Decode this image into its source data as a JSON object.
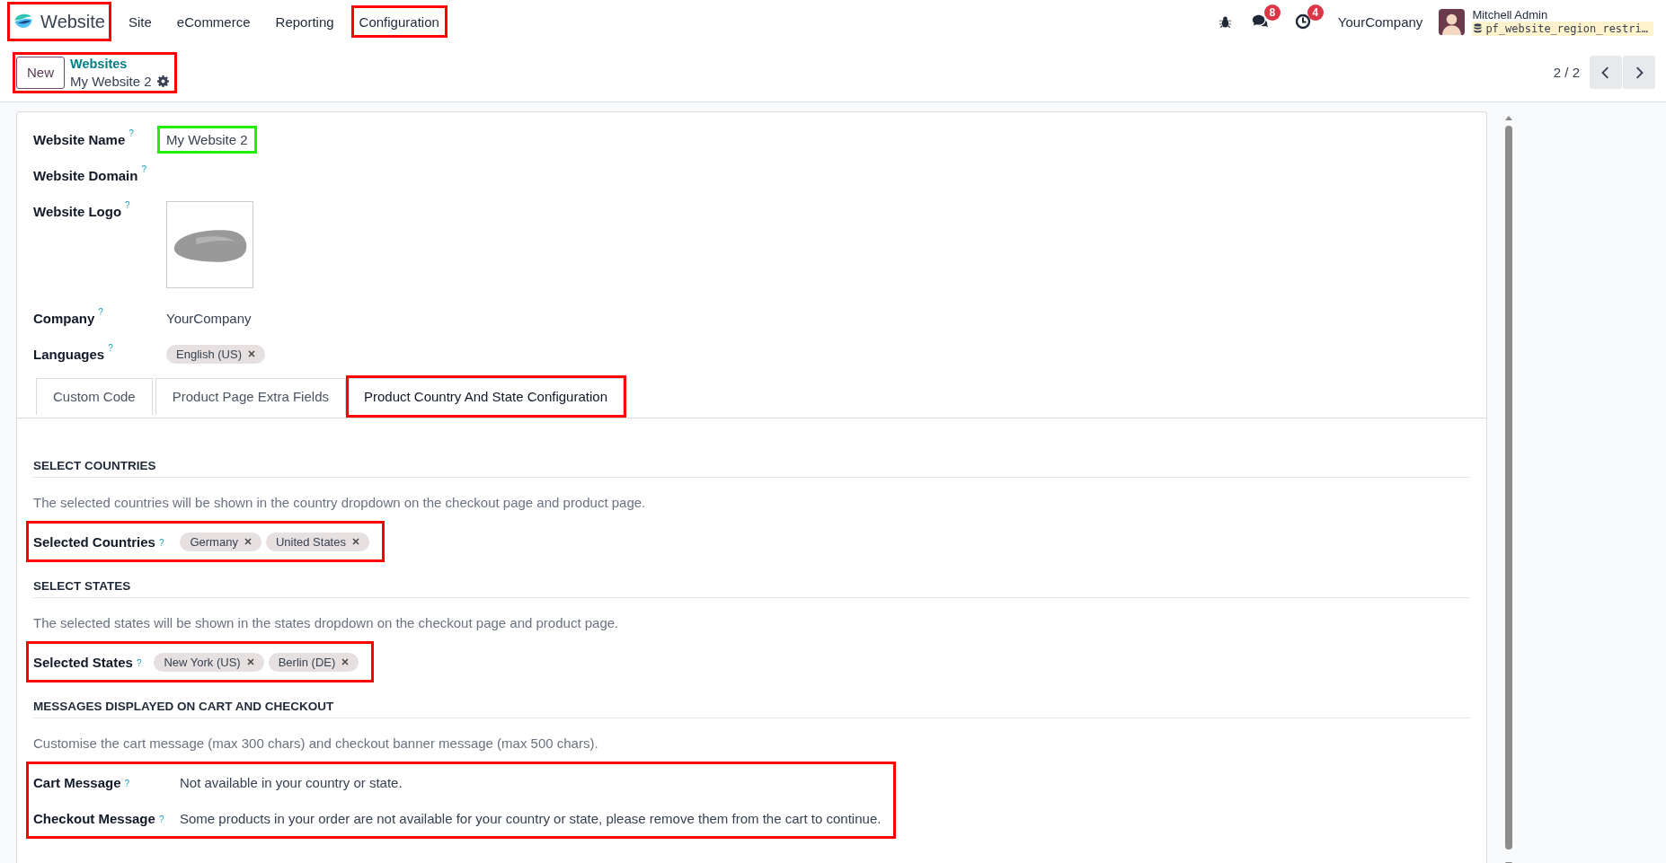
{
  "navbar": {
    "app": {
      "name": "Website",
      "color": "#ff0000"
    },
    "menus": [
      {
        "label": "Site"
      },
      {
        "label": "eCommerce"
      },
      {
        "label": "Reporting"
      },
      {
        "label": "Configuration",
        "color": "#ff0000"
      }
    ],
    "systray": {
      "notifications": [
        {
          "kind": "chat",
          "count": "8"
        },
        {
          "kind": "activity",
          "count": "4"
        }
      ],
      "company": "YourCompany",
      "user": {
        "name": "Mitchell Admin",
        "database": "pf_website_region_restri…"
      }
    }
  },
  "control_panel": {
    "new_button": "New",
    "breadcrumb": {
      "parent": "Websites",
      "current": "My Website 2"
    },
    "color": "#ff0000",
    "pager": "2 / 2"
  },
  "form": {
    "fields": [
      {
        "kind": "text",
        "label": "Website Name",
        "help": "?",
        "value": "My Website 2",
        "color": "#22ee00"
      },
      {
        "kind": "text",
        "label": "Website Domain",
        "help": "?"
      },
      {
        "label": "Website Logo",
        "help": "?"
      },
      {
        "kind": "text",
        "label": "Company",
        "help": "?",
        "value": "YourCompany"
      },
      {
        "kind": "tags",
        "label": "Languages",
        "help": "?",
        "tags": [
          "English (US)"
        ]
      }
    ],
    "tabs": [
      {
        "label": "Custom Code",
        "selected": false
      },
      {
        "label": "Product Page Extra Fields",
        "selected": false
      },
      {
        "label": "Product Country And State Configuration",
        "selected": true,
        "color": "#ff0000"
      }
    ],
    "sections": [
      {
        "title": "SELECT COUNTRIES",
        "description": "The selected countries will be shown in the country dropdown on the checkout page and product page.",
        "color": "#ff0000",
        "fields": [
          {
            "kind": "tags",
            "label": "Selected Countries",
            "help": "?",
            "tags": [
              "Germany",
              "United States"
            ]
          }
        ]
      },
      {
        "title": "SELECT STATES",
        "description": "The selected states will be shown in the states dropdown on the checkout page and product page.",
        "color": "#ff0000",
        "fields": [
          {
            "kind": "tags",
            "label": "Selected States",
            "help": "?",
            "tags": [
              "New York (US)",
              "Berlin (DE)"
            ]
          }
        ]
      },
      {
        "title": "MESSAGES DISPLAYED ON CART AND CHECKOUT",
        "description": "Customise the cart message (max 300 chars) and checkout banner message (max 500 chars).",
        "color": "#ff0000",
        "fields": [
          {
            "kind": "text",
            "label": "Cart Message",
            "help": "?",
            "value": "Not available in your country or state."
          },
          {
            "kind": "text",
            "label": "Checkout Message",
            "help": "?",
            "value": "Some products in your order are not available for your country or state, please remove them from the cart to continue."
          }
        ]
      }
    ]
  }
}
